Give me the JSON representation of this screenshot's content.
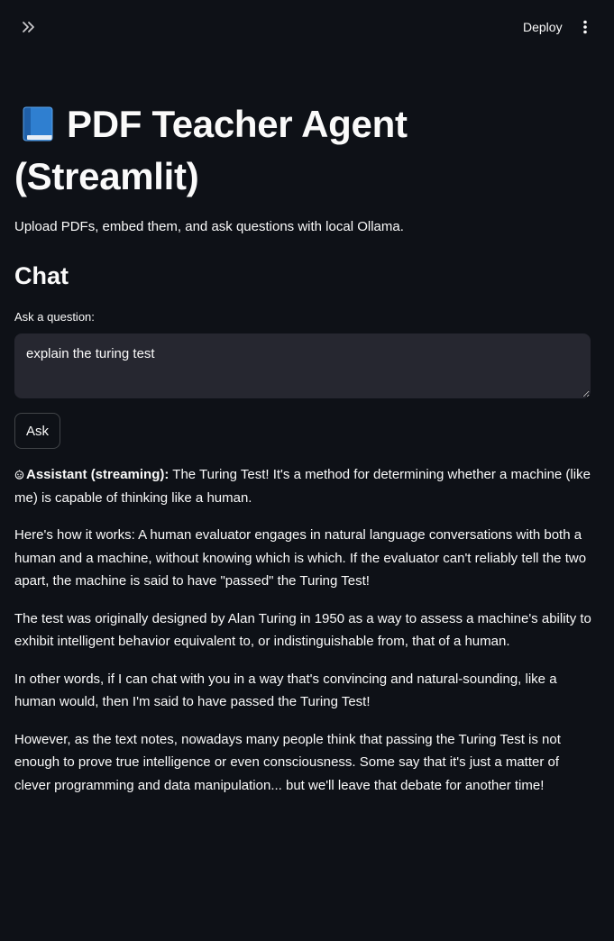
{
  "header": {
    "expand_icon": "double-chevron-right-icon",
    "deploy_label": "Deploy",
    "menu_icon": "vertical-dots-icon"
  },
  "page": {
    "title_emoji": "📘",
    "title": "PDF Teacher Agent (Streamlit)",
    "caption": "Upload PDFs, embed them, and ask questions with local Ollama."
  },
  "chat": {
    "heading": "Chat",
    "input_label": "Ask a question:",
    "input_value": "explain the turing test",
    "ask_label": "Ask"
  },
  "answer": {
    "icon": "robot-icon",
    "label": "Assistant (streaming):",
    "paragraphs": [
      "The Turing Test! It's a method for determining whether a machine (like me) is capable of thinking like a human.",
      "Here's how it works: A human evaluator engages in natural language conversations with both a human and a machine, without knowing which is which. If the evaluator can't reliably tell the two apart, the machine is said to have \"passed\" the Turing Test!",
      "The test was originally designed by Alan Turing in 1950 as a way to assess a machine's ability to exhibit intelligent behavior equivalent to, or indistinguishable from, that of a human.",
      "In other words, if I can chat with you in a way that's convincing and natural-sounding, like a human would, then I'm said to have passed the Turing Test!",
      "However, as the text notes, nowadays many people think that passing the Turing Test is not enough to prove true intelligence or even consciousness. Some say that it's just a matter of clever programming and data manipulation... but we'll leave that debate for another time!"
    ]
  },
  "colors": {
    "background": "#0e1117",
    "text": "#fafafa",
    "input_background": "#262730"
  }
}
